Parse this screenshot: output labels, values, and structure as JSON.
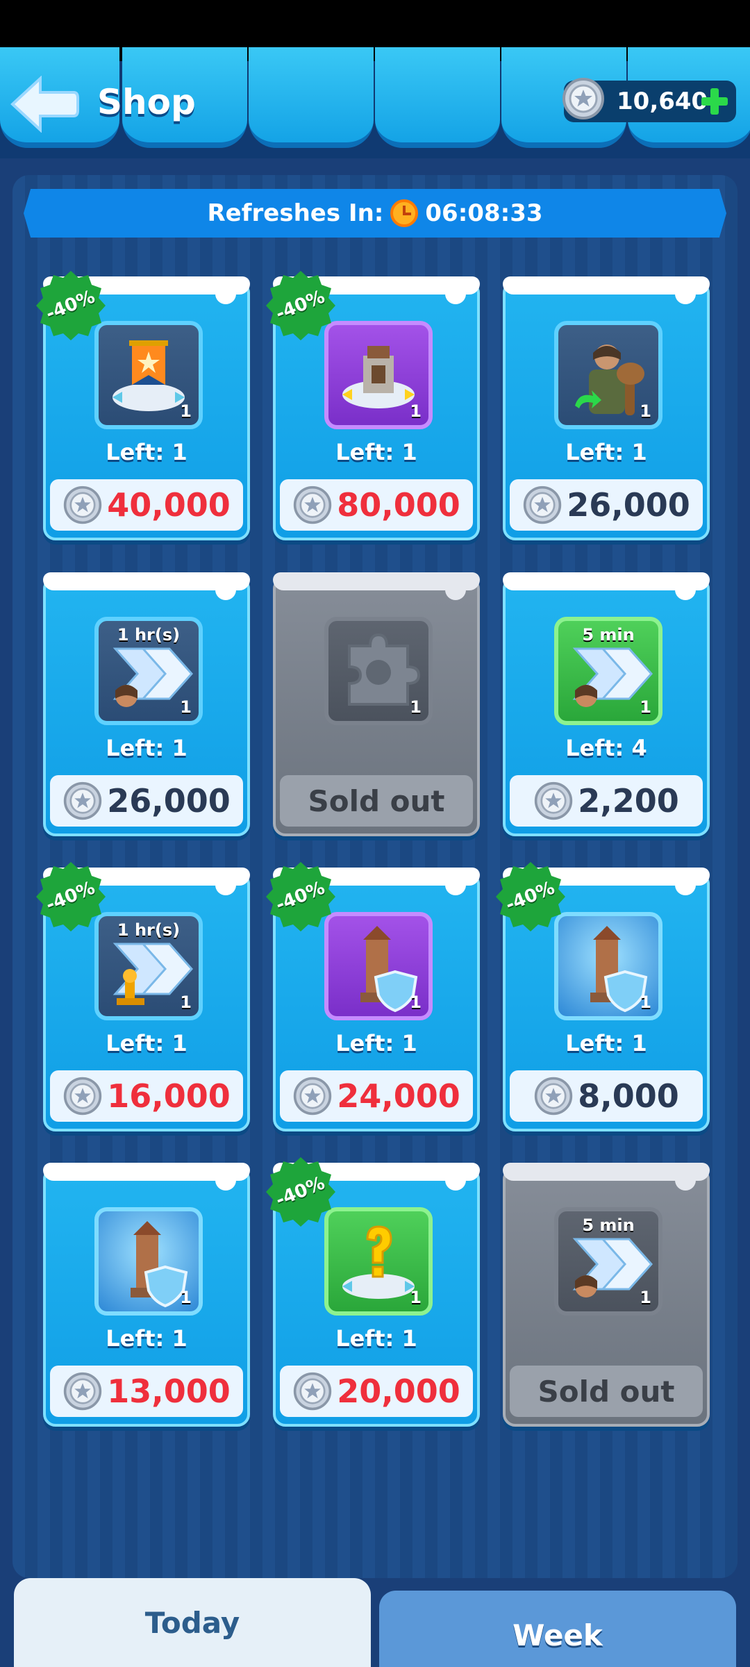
{
  "header": {
    "title": "Shop",
    "balance": "10,640"
  },
  "refresh": {
    "label": "Refreshes In:",
    "time": "06:08:33"
  },
  "items": [
    {
      "name": "banner-item",
      "discount": "-40%",
      "tile": "blue-gray",
      "icon": "banner-icon",
      "qty": "1",
      "left": "Left: 1",
      "price": "40,000",
      "discounted": true,
      "sold_out": false
    },
    {
      "name": "tower-item",
      "discount": "-40%",
      "tile": "purple",
      "icon": "tower-icon",
      "qty": "1",
      "left": "Left: 1",
      "price": "80,000",
      "discounted": true,
      "sold_out": false
    },
    {
      "name": "warrior-item",
      "discount": "",
      "tile": "blue-gray",
      "icon": "warrior-icon",
      "qty": "1",
      "left": "Left: 1",
      "price": "26,000",
      "discounted": false,
      "sold_out": false
    },
    {
      "name": "speedup-1hr-item",
      "discount": "",
      "tile": "blue-gray",
      "icon": "speedup-icon",
      "tile_label": "1 hr(s)",
      "qty": "1",
      "left": "Left: 1",
      "price": "26,000",
      "discounted": false,
      "sold_out": false
    },
    {
      "name": "puzzle-item",
      "discount": "",
      "tile": "gray",
      "icon": "puzzle-piece-icon",
      "qty": "1",
      "left": "",
      "price": "",
      "sold_out_label": "Sold out",
      "sold_out": true
    },
    {
      "name": "speedup-5min-item",
      "discount": "",
      "tile": "green",
      "icon": "speedup-icon",
      "tile_label": "5 min",
      "qty": "1",
      "left": "Left: 4",
      "price": "2,200",
      "discounted": false,
      "sold_out": false
    },
    {
      "name": "research-speedup-item",
      "discount": "-40%",
      "tile": "blue-gray",
      "icon": "research-speedup-icon",
      "tile_label": "1 hr(s)",
      "qty": "1",
      "left": "Left: 1",
      "price": "16,000",
      "discounted": true,
      "sold_out": false
    },
    {
      "name": "shield-tower-purple-item",
      "discount": "-40%",
      "tile": "purple",
      "icon": "shield-tower-icon",
      "qty": "1",
      "left": "Left: 1",
      "price": "24,000",
      "discounted": true,
      "sold_out": false
    },
    {
      "name": "shield-tower-blue-item",
      "discount": "-40%",
      "tile": "blue",
      "icon": "shield-tower-icon",
      "qty": "1",
      "left": "Left: 1",
      "price": "8,000",
      "discounted": false,
      "sold_out": false
    },
    {
      "name": "shield-tower-item",
      "discount": "",
      "tile": "blue",
      "icon": "shield-tower-icon",
      "qty": "1",
      "left": "Left: 1",
      "price": "13,000",
      "discounted": true,
      "sold_out": false
    },
    {
      "name": "mystery-item",
      "discount": "-40%",
      "tile": "green",
      "icon": "question-mark-icon",
      "qty": "1",
      "left": "Left: 1",
      "price": "20,000",
      "discounted": true,
      "sold_out": false
    },
    {
      "name": "speedup-5min-soldout-item",
      "discount": "",
      "tile": "gray",
      "icon": "speedup-icon",
      "tile_label": "5 min",
      "qty": "1",
      "left": "",
      "price": "",
      "sold_out_label": "Sold out",
      "sold_out": true
    }
  ],
  "tabs": {
    "today": "Today",
    "week": "Week"
  }
}
